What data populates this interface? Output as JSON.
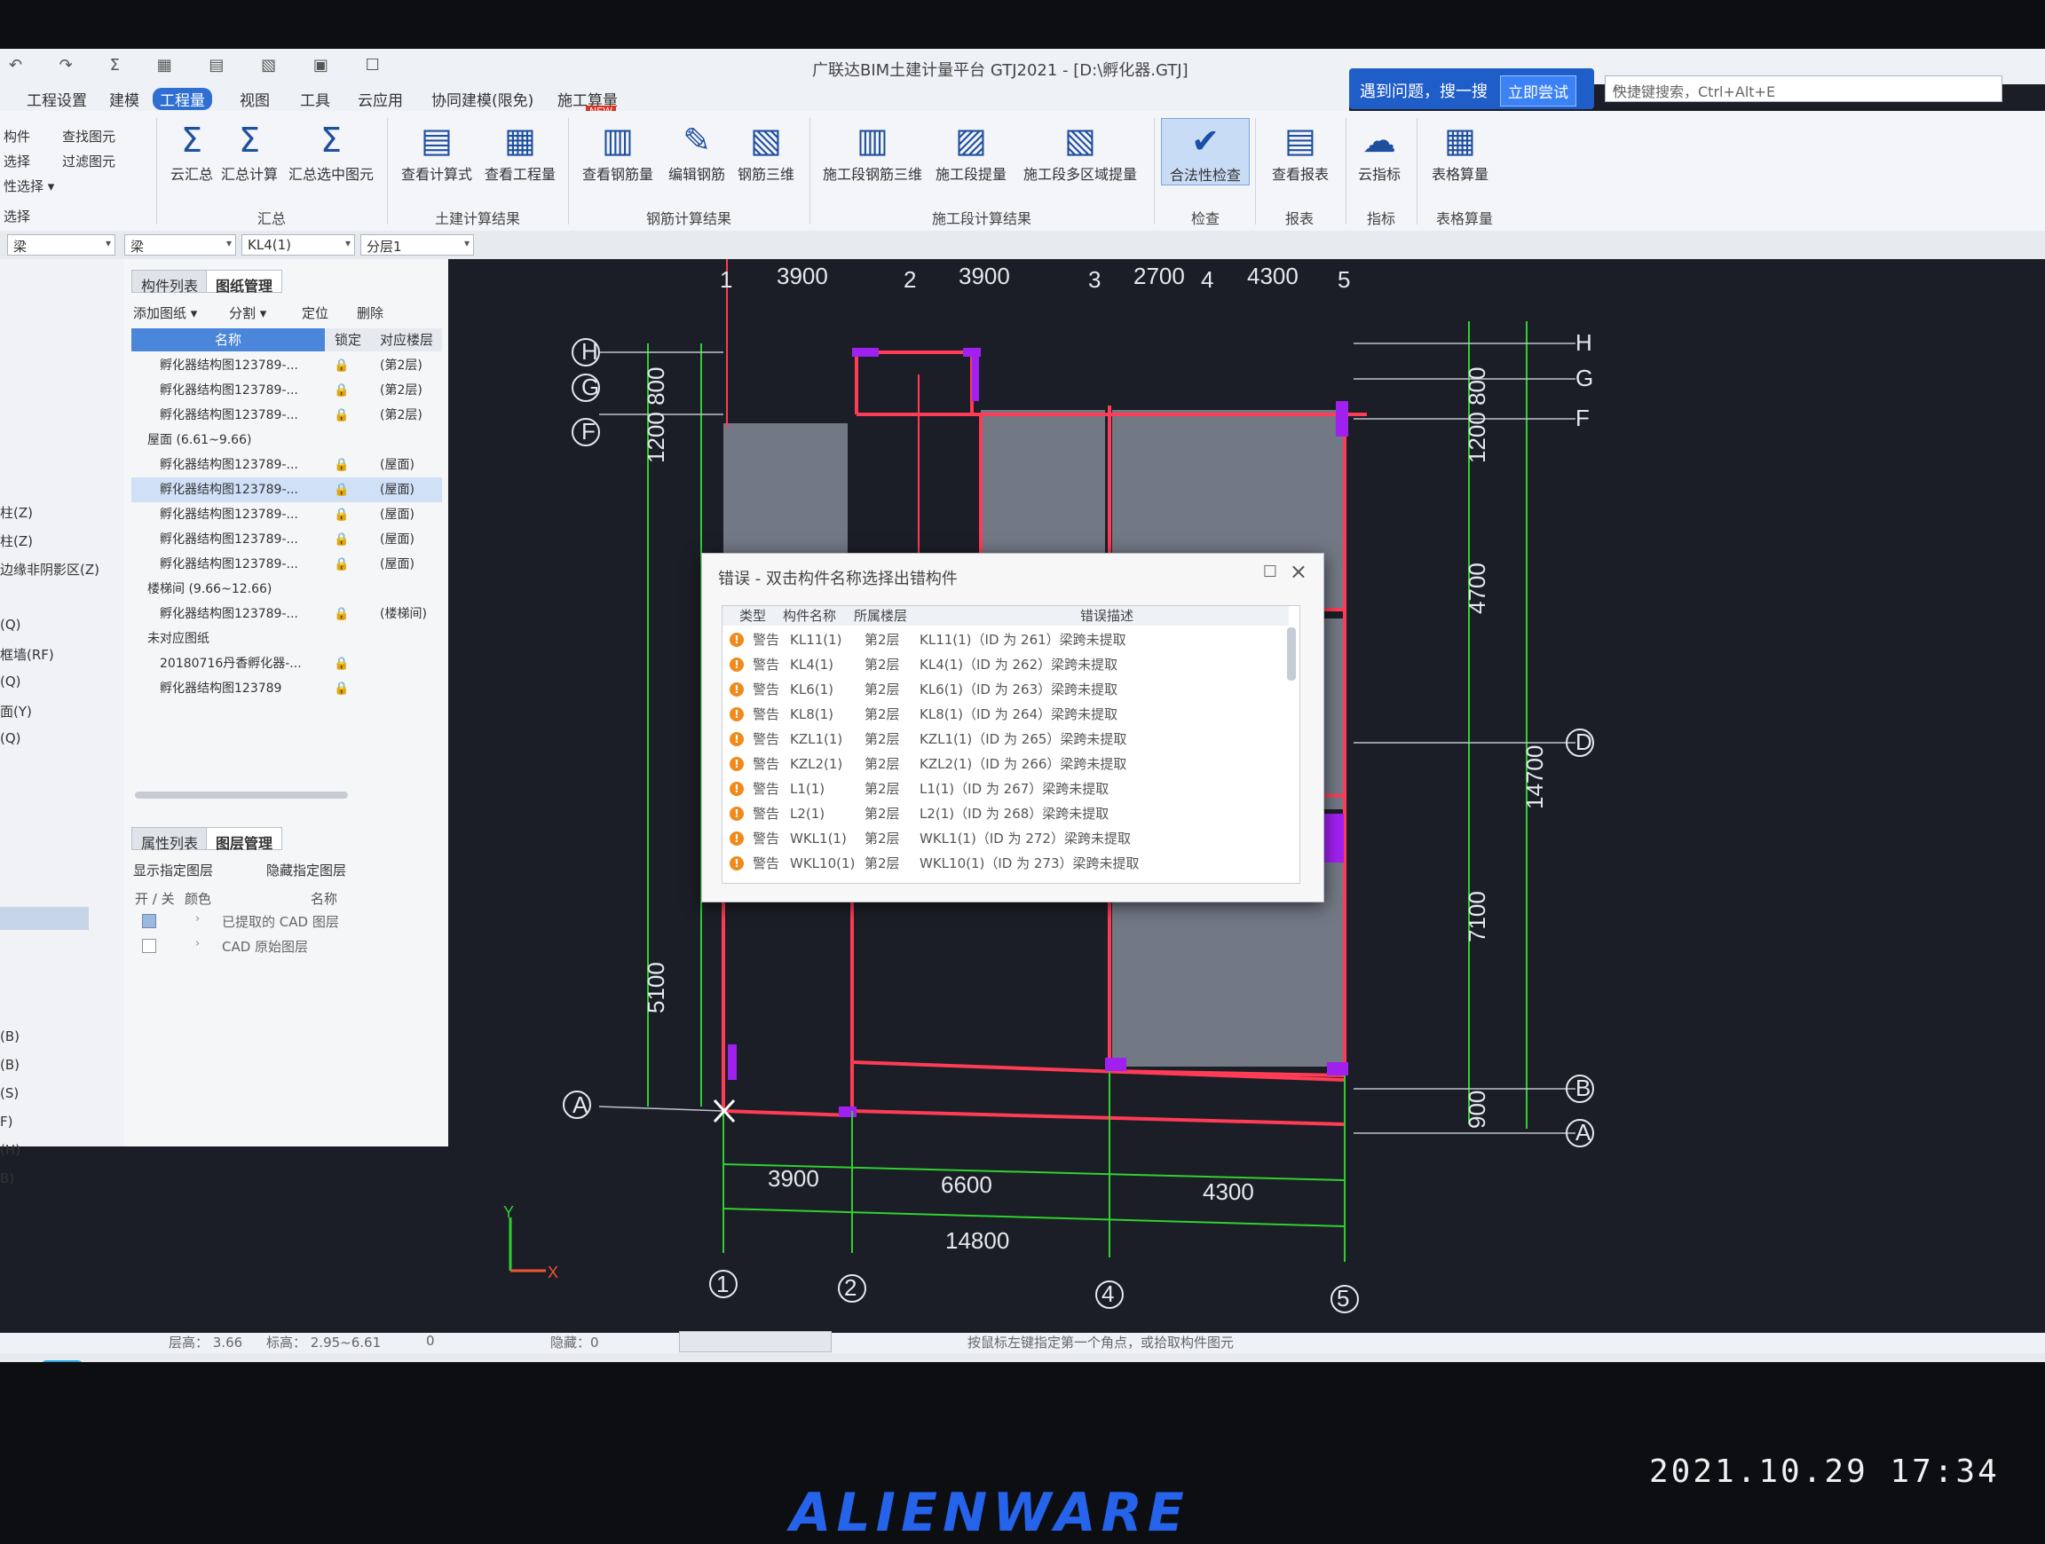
{
  "app": {
    "title": "广联达BIM土建计量平台 GTJ2021 - [D:\\孵化器.GTJ]",
    "quick_access": "↶ ↷ Σ ▦ ▤ ▧ ▣ ☐"
  },
  "menu": {
    "tabs": [
      "工程设置",
      "建模",
      "工程量",
      "视图",
      "工具",
      "云应用",
      "协同建模(限免)",
      "施工算量"
    ],
    "active": "工程量",
    "new_badge": "NEW"
  },
  "help": {
    "ask": "遇到问题，搜一搜",
    "try": "立即尝试",
    "search_placeholder": "快捷键搜索，Ctrl+Alt+E"
  },
  "ribbon": {
    "side_items": [
      "构件",
      "选择",
      "性选择 ▾"
    ],
    "side_group": "选择",
    "find_btn": "查找图元",
    "filter_btn": "过滤图元",
    "buttons": [
      {
        "label": "云汇总",
        "icon": "Σ"
      },
      {
        "label": "汇总计算",
        "icon": "Σ"
      },
      {
        "label": "汇总选中图元",
        "icon": "Σ"
      },
      {
        "label": "查看计算式",
        "icon": "▤"
      },
      {
        "label": "查看工程量",
        "icon": "▦"
      },
      {
        "label": "查看钢筋量",
        "icon": "▥"
      },
      {
        "label": "编辑钢筋",
        "icon": "✎"
      },
      {
        "label": "钢筋三维",
        "icon": "▧"
      },
      {
        "label": "施工段钢筋三维",
        "icon": "▥"
      },
      {
        "label": "施工段提量",
        "icon": "▨"
      },
      {
        "label": "施工段多区域提量",
        "icon": "▧"
      },
      {
        "label": "合法性检查",
        "icon": "✔"
      },
      {
        "label": "查看报表",
        "icon": "▤"
      },
      {
        "label": "云指标",
        "icon": "☁"
      },
      {
        "label": "表格算量",
        "icon": "▦"
      }
    ],
    "groups": [
      "汇总",
      "土建计算结果",
      "钢筋计算结果",
      "施工段计算结果",
      "检查",
      "报表",
      "指标",
      "表格算量"
    ]
  },
  "selectors": [
    "梁",
    "梁",
    "KL4(1)",
    "分层1"
  ],
  "left_panel": {
    "items": [
      "柱(Z)",
      "柱(Z)",
      "边缘非阴影区(Z)",
      "(Q)",
      "框墙(RF)",
      "(Q)",
      "面(Y)",
      "(Q)",
      "(B)",
      "(B)",
      "(S)",
      "F)",
      "(H)",
      "B)"
    ]
  },
  "drawing_panel": {
    "tabs": [
      "构件列表",
      "图纸管理"
    ],
    "tools": [
      "添加图纸 ▾",
      "分割 ▾",
      "定位",
      "删除"
    ],
    "columns": [
      "名称",
      "锁定",
      "对应楼层"
    ],
    "rows": [
      {
        "name": "孵化器结构图123789-...",
        "floor": "(第2层)",
        "group": false,
        "selected": false
      },
      {
        "name": "孵化器结构图123789-...",
        "floor": "(第2层)",
        "group": false,
        "selected": false
      },
      {
        "name": "孵化器结构图123789-...",
        "floor": "(第2层)",
        "group": false,
        "selected": false
      },
      {
        "name": "屋面 (6.61~9.66)",
        "floor": "",
        "group": true,
        "selected": false
      },
      {
        "name": "孵化器结构图123789-...",
        "floor": "(屋面)",
        "group": false,
        "selected": false
      },
      {
        "name": "孵化器结构图123789-...",
        "floor": "(屋面)",
        "group": false,
        "selected": true
      },
      {
        "name": "孵化器结构图123789-...",
        "floor": "(屋面)",
        "group": false,
        "selected": false
      },
      {
        "name": "孵化器结构图123789-...",
        "floor": "(屋面)",
        "group": false,
        "selected": false
      },
      {
        "name": "孵化器结构图123789-...",
        "floor": "(屋面)",
        "group": false,
        "selected": false
      },
      {
        "name": "楼梯间 (9.66~12.66)",
        "floor": "",
        "group": true,
        "selected": false
      },
      {
        "name": "孵化器结构图123789-...",
        "floor": "(楼梯间)",
        "group": false,
        "selected": false
      },
      {
        "name": "未对应图纸",
        "floor": "",
        "group": true,
        "selected": false
      },
      {
        "name": "20180716丹香孵化器-...",
        "floor": "",
        "group": false,
        "selected": false
      },
      {
        "name": "孵化器结构图123789",
        "floor": "",
        "group": false,
        "selected": false
      }
    ]
  },
  "layer_panel": {
    "tabs": [
      "属性列表",
      "图层管理"
    ],
    "show_btn": "显示指定图层",
    "hide_btn": "隐藏指定图层",
    "columns": [
      "开 / 关",
      "颜色",
      "名称"
    ],
    "rows": [
      "已提取的 CAD 图层",
      "CAD 原始图层"
    ]
  },
  "canvas": {
    "grid_top": [
      "1",
      "3900",
      "2",
      "3900",
      "3",
      "2700",
      "4",
      "4300",
      "5"
    ],
    "grid_left": [
      "H",
      "G",
      "F",
      "A"
    ],
    "grid_right": [
      "H",
      "G",
      "F",
      "D",
      "B",
      "A"
    ],
    "dims_right": [
      "1200 800",
      "1200 800",
      "4700",
      "14700",
      "7100",
      "900"
    ],
    "dim_left": "5100",
    "dims_bottom": [
      "3900",
      "6600",
      "4300",
      "14800"
    ],
    "axis_bottom": [
      "1",
      "2",
      "4",
      "5"
    ],
    "axis_labels": [
      "Y",
      "X"
    ]
  },
  "dialog": {
    "title": "错误 - 双击构件名称选择出错构件",
    "columns": [
      "类型",
      "构件名称",
      "所属楼层",
      "错误描述"
    ],
    "rows": [
      {
        "type": "警告",
        "name": "KL11(1)",
        "floor": "第2层",
        "desc": "KL11(1)（ID 为 261）梁跨未提取"
      },
      {
        "type": "警告",
        "name": "KL4(1)",
        "floor": "第2层",
        "desc": "KL4(1)（ID 为 262）梁跨未提取"
      },
      {
        "type": "警告",
        "name": "KL6(1)",
        "floor": "第2层",
        "desc": "KL6(1)（ID 为 263）梁跨未提取"
      },
      {
        "type": "警告",
        "name": "KL8(1)",
        "floor": "第2层",
        "desc": "KL8(1)（ID 为 264）梁跨未提取"
      },
      {
        "type": "警告",
        "name": "KZL1(1)",
        "floor": "第2层",
        "desc": "KZL1(1)（ID 为 265）梁跨未提取"
      },
      {
        "type": "警告",
        "name": "KZL2(1)",
        "floor": "第2层",
        "desc": "KZL2(1)（ID 为 266）梁跨未提取"
      },
      {
        "type": "警告",
        "name": "L1(1)",
        "floor": "第2层",
        "desc": "L1(1)（ID 为 267）梁跨未提取"
      },
      {
        "type": "警告",
        "name": "L2(1)",
        "floor": "第2层",
        "desc": "L2(1)（ID 为 268）梁跨未提取"
      },
      {
        "type": "警告",
        "name": "WKL1(1)",
        "floor": "第2层",
        "desc": "WKL1(1)（ID 为 272）梁跨未提取"
      },
      {
        "type": "警告",
        "name": "WKL10(1)",
        "floor": "第2层",
        "desc": "WKL10(1)（ID 为 273）梁跨未提取"
      }
    ]
  },
  "status": {
    "floor_height": "层高： 3.66",
    "elevation": "标高： 2.95~6.61",
    "count": "0",
    "hidden": "隐藏：0",
    "hint": "按鼠标左键指定第一个角点，或拾取构件图元"
  },
  "overlay": {
    "timestamp": "2021.10.29 17:34",
    "brand": "ALIENWARE"
  },
  "colors": {
    "accent": "#2f6fd1",
    "beam": "#ff3b55",
    "column": "#a020f0",
    "dim": "#2fd12f",
    "warn": "#f08a1c"
  }
}
